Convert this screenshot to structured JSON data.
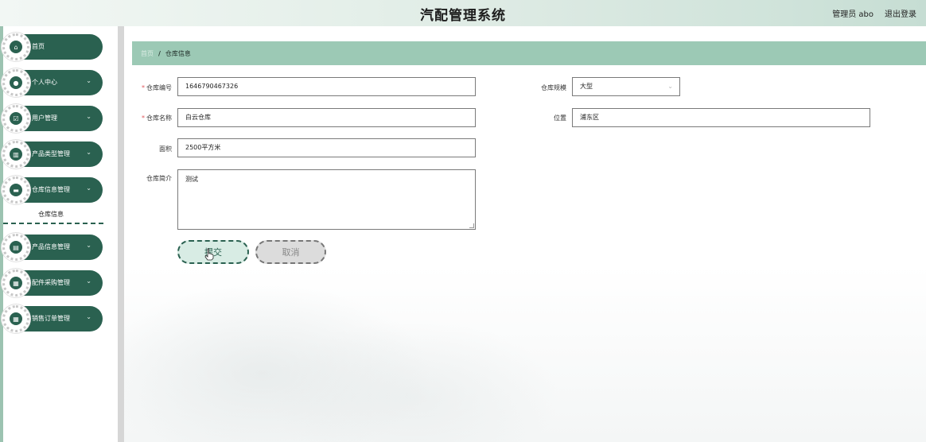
{
  "header": {
    "title": "汽配管理系统",
    "user_label": "管理员 abo",
    "logout_label": "退出登录"
  },
  "sidebar": {
    "items": [
      {
        "label": "首页",
        "icon": "home-icon",
        "glyph": "⌂"
      },
      {
        "label": "个人中心",
        "icon": "person-icon",
        "glyph": "●"
      },
      {
        "label": "用户管理",
        "icon": "user-check-icon",
        "glyph": "☑"
      },
      {
        "label": "产品类型管理",
        "icon": "bar-chart-icon",
        "glyph": "▥"
      },
      {
        "label": "仓库信息管理",
        "icon": "monitor-icon",
        "glyph": "▬"
      },
      {
        "label": "产品信息管理",
        "icon": "database-icon",
        "glyph": "▤"
      },
      {
        "label": "配件采购管理",
        "icon": "grid-icon",
        "glyph": "▦"
      },
      {
        "label": "销售订单管理",
        "icon": "grid-icon",
        "glyph": "▦"
      }
    ],
    "submenu": {
      "label": "仓库信息"
    },
    "chevron": "⌄"
  },
  "breadcrumb": {
    "home": "首页",
    "separator": "/",
    "current": "仓库信息"
  },
  "form": {
    "warehouse_no": {
      "label": "仓库编号",
      "value": "1646790467326",
      "required": "*"
    },
    "warehouse_name": {
      "label": "仓库名称",
      "value": "白云仓库",
      "required": "*"
    },
    "area": {
      "label": "面积",
      "value": "2500平方米"
    },
    "intro": {
      "label": "仓库简介",
      "value": "测试"
    },
    "scale": {
      "label": "仓库规模",
      "value": "大型"
    },
    "location": {
      "label": "位置",
      "value": "浦东区"
    }
  },
  "buttons": {
    "submit": "提交",
    "cancel": "取消"
  },
  "colors": {
    "primary": "#2a6150",
    "breadcrumb_bg": "#9cc9b5",
    "required": "#e0565b"
  }
}
